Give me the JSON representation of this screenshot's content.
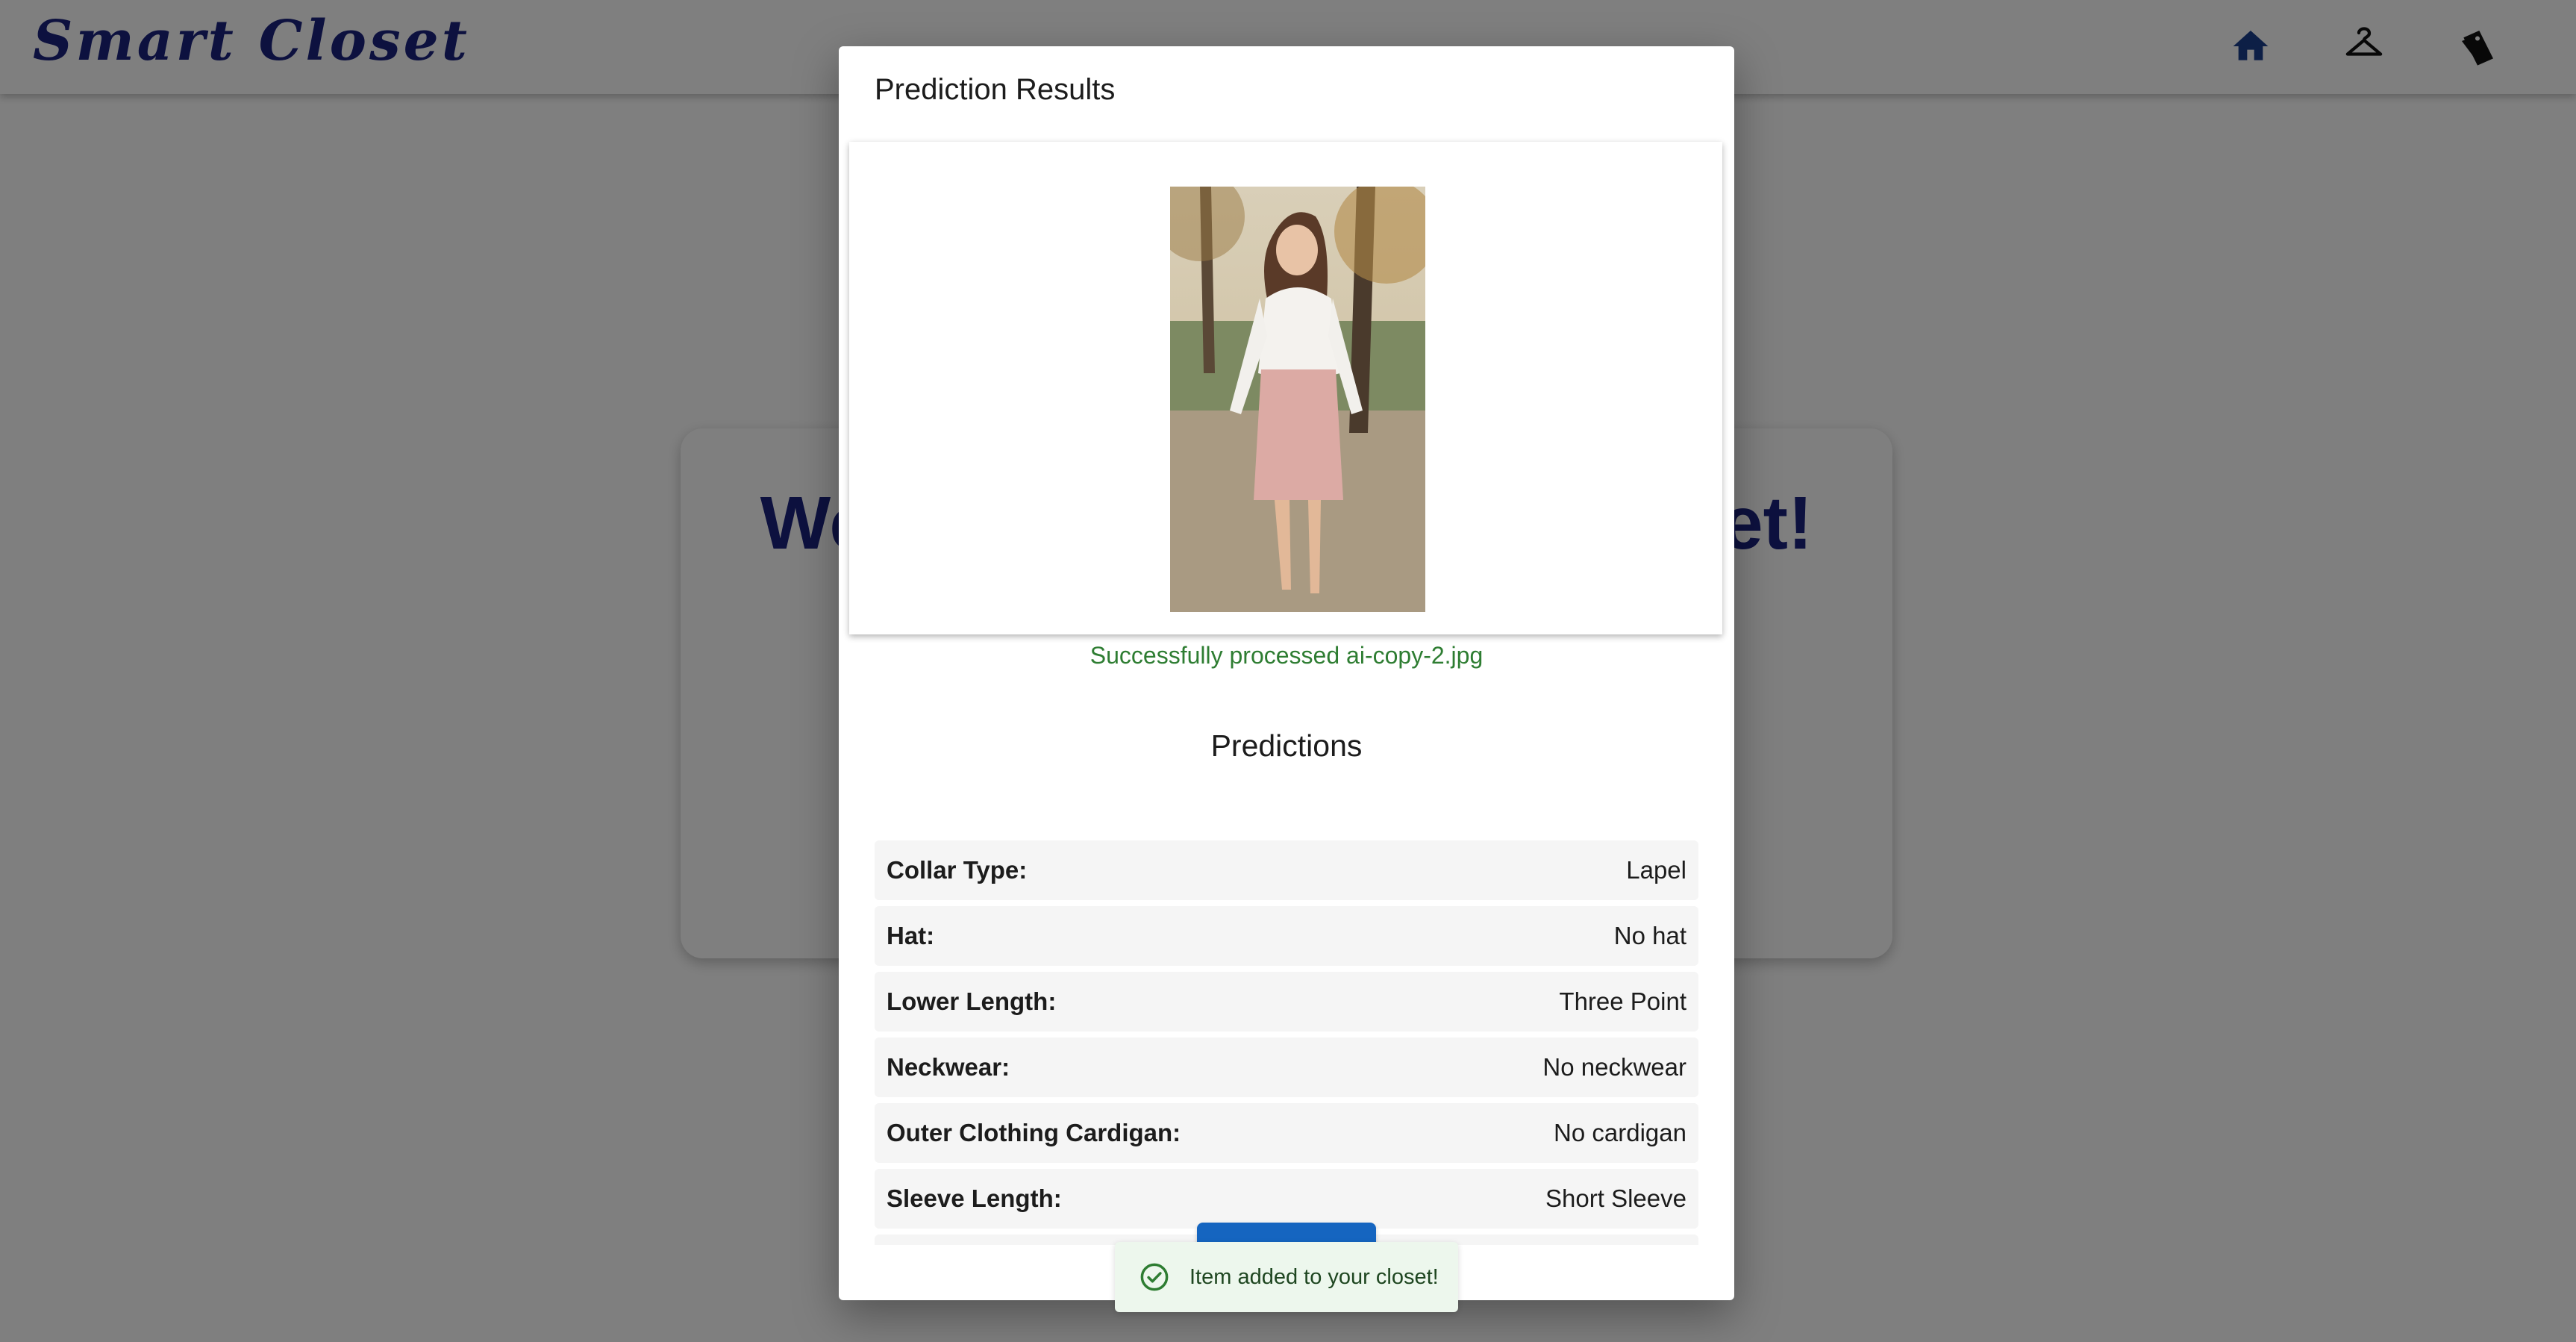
{
  "navbar": {
    "brand": "Smart Closet",
    "icons": [
      "home-icon",
      "hanger-icon",
      "tags-icon"
    ],
    "active_icon_color": "#1a3e8c"
  },
  "welcome": {
    "title_left": "We",
    "title_right": "et!"
  },
  "modal": {
    "title": "Prediction Results",
    "image_alt": "ai-copy-2.jpg",
    "success_message": "Successfully processed ai-copy-2.jpg",
    "predictions_heading": "Predictions",
    "predictions": [
      {
        "label": "Collar Type:",
        "value": "Lapel"
      },
      {
        "label": "Hat:",
        "value": "No hat"
      },
      {
        "label": "Lower Length:",
        "value": "Three Point"
      },
      {
        "label": "Neckwear:",
        "value": "No neckwear"
      },
      {
        "label": "Outer Clothing Cardigan:",
        "value": "No cardigan"
      },
      {
        "label": "Sleeve Length:",
        "value": "Short Sleeve"
      }
    ],
    "button_color": "#1565c0"
  },
  "toast": {
    "icon": "check-circle-icon",
    "message": "Item added to your closet!",
    "color": "#2e7d32"
  }
}
